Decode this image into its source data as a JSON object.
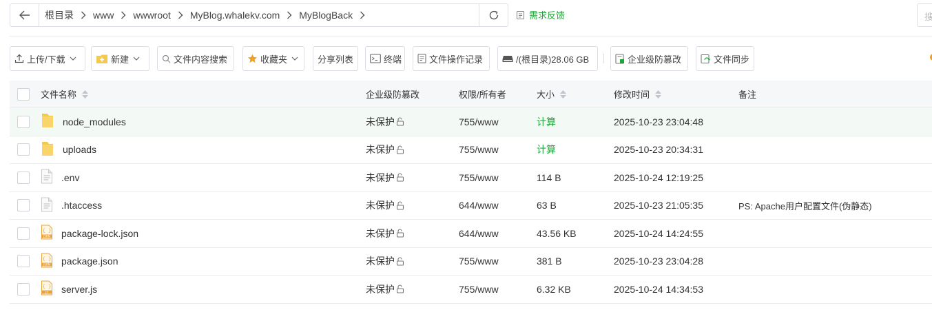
{
  "breadcrumb": {
    "items": [
      "根目录",
      "www",
      "wwwroot",
      "MyBlog.whalekv.com",
      "MyBlogBack"
    ]
  },
  "feedback": {
    "label": "需求反馈"
  },
  "search": {
    "placeholder": "搜"
  },
  "toolbar": {
    "upload": "上传/下载",
    "new": "新建",
    "content_search": "文件内容搜索",
    "favorites": "收藏夹",
    "share_list": "分享列表",
    "terminal": "终端",
    "op_log": "文件操作记录",
    "disk": "/(根目录)28.06 GB",
    "tamper": "企业级防篡改",
    "sync": "文件同步"
  },
  "table": {
    "headers": {
      "name": "文件名称",
      "tamper": "企业级防篡改",
      "perm": "权限/所有者",
      "size": "大小",
      "time": "修改时间",
      "note": "备注"
    },
    "rows": [
      {
        "name": "node_modules",
        "type": "folder",
        "tamper": "未保护",
        "perm": "755/www",
        "size": "计算",
        "time": "2025-10-23 23:04:48",
        "note": ""
      },
      {
        "name": "uploads",
        "type": "folder",
        "tamper": "未保护",
        "perm": "755/www",
        "size": "计算",
        "time": "2025-10-23 20:34:31",
        "note": ""
      },
      {
        "name": ".env",
        "type": "file",
        "tamper": "未保护",
        "perm": "755/www",
        "size": "114 B",
        "time": "2025-10-24 12:19:25",
        "note": ""
      },
      {
        "name": ".htaccess",
        "type": "file",
        "tamper": "未保护",
        "perm": "644/www",
        "size": "63 B",
        "time": "2025-10-23 21:05:35",
        "note": "PS: Apache用户配置文件(伪静态)"
      },
      {
        "name": "package-lock.json",
        "type": "json",
        "tamper": "未保护",
        "perm": "644/www",
        "size": "43.56 KB",
        "time": "2025-10-24 14:24:55",
        "note": ""
      },
      {
        "name": "package.json",
        "type": "json",
        "tamper": "未保护",
        "perm": "755/www",
        "size": "381 B",
        "time": "2025-10-23 23:04:28",
        "note": ""
      },
      {
        "name": "server.js",
        "type": "js",
        "tamper": "未保护",
        "perm": "755/www",
        "size": "6.32 KB",
        "time": "2025-10-24 14:34:53",
        "note": ""
      }
    ]
  },
  "colors": {
    "accent": "#20a53a",
    "folder": "#f5c94e",
    "json_icon": "#e8a33c"
  }
}
